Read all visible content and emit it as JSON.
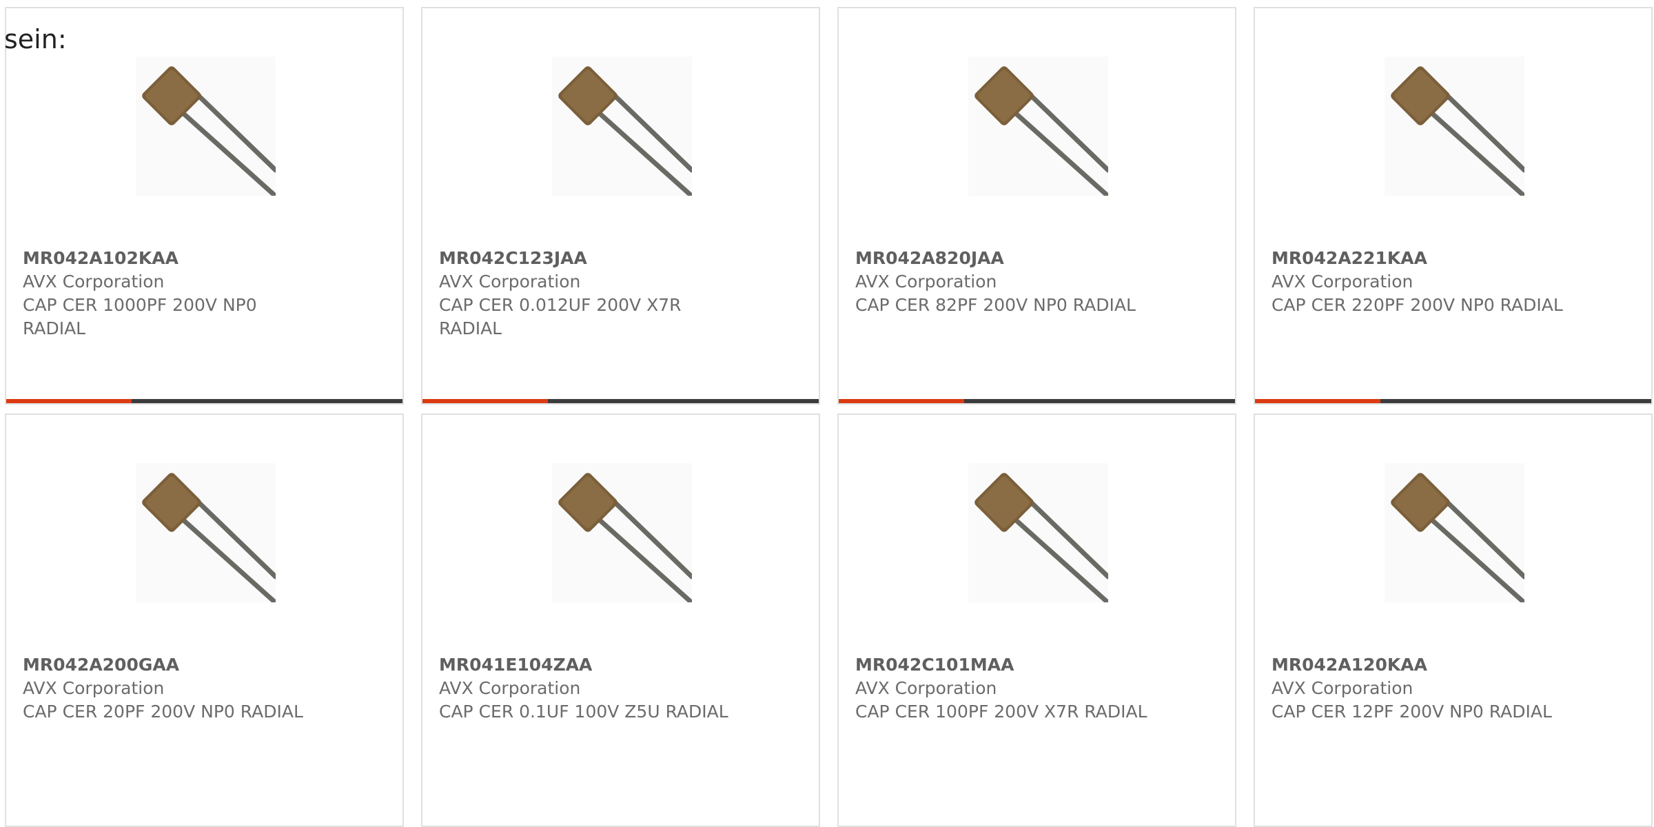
{
  "heading": "sein:",
  "colors": {
    "accent": "#dc3a12",
    "bar": "#3c3c3c",
    "border": "#e0e0e0",
    "text": "#6b6b6b"
  },
  "products": [
    {
      "pn": "MR042A102KAA",
      "mfr": "AVX Corporation",
      "desc": "CAP CER 1000PF 200V NP0 RADIAL",
      "image": "radial-capacitor-image"
    },
    {
      "pn": "MR042C123JAA",
      "mfr": "AVX Corporation",
      "desc": "CAP CER 0.012UF 200V X7R RADIAL",
      "image": "radial-capacitor-image"
    },
    {
      "pn": "MR042A820JAA",
      "mfr": "AVX Corporation",
      "desc": "CAP CER 82PF 200V NP0 RADIAL",
      "image": "radial-capacitor-image"
    },
    {
      "pn": "MR042A221KAA",
      "mfr": "AVX Corporation",
      "desc": "CAP CER 220PF 200V NP0 RADIAL",
      "image": "radial-capacitor-image"
    },
    {
      "pn": "MR042A200GAA",
      "mfr": "AVX Corporation",
      "desc": "CAP CER 20PF 200V NP0 RADIAL",
      "image": "radial-capacitor-image"
    },
    {
      "pn": "MR041E104ZAA",
      "mfr": "AVX Corporation",
      "desc": "CAP CER 0.1UF 100V Z5U RADIAL",
      "image": "radial-capacitor-image"
    },
    {
      "pn": "MR042C101MAA",
      "mfr": "AVX Corporation",
      "desc": "CAP CER 100PF 200V X7R RADIAL",
      "image": "radial-capacitor-image"
    },
    {
      "pn": "MR042A120KAA",
      "mfr": "AVX Corporation",
      "desc": "CAP CER 12PF 200V NP0 RADIAL",
      "image": "radial-capacitor-image"
    }
  ]
}
